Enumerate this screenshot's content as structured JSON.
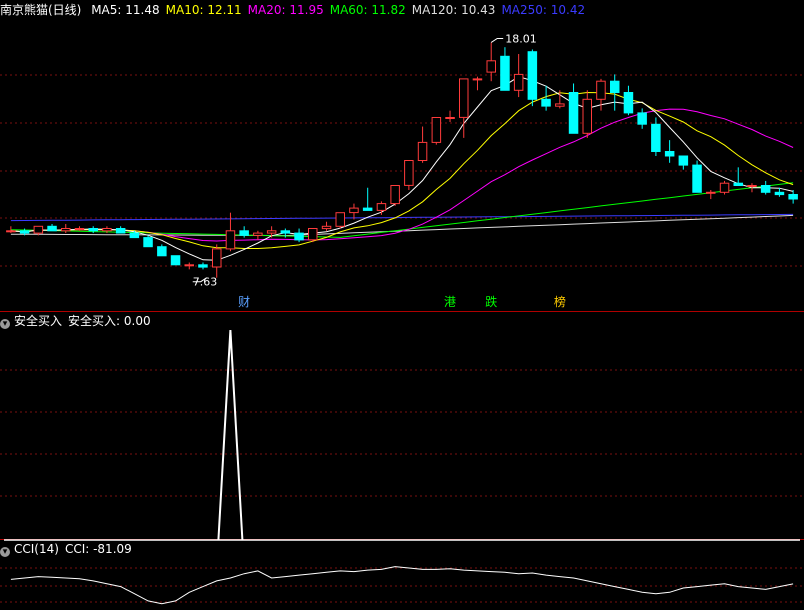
{
  "panels": {
    "main": {
      "title": "南京熊猫(日线)",
      "legend": [
        {
          "label": "MA5: 11.48",
          "color": "#ffffff"
        },
        {
          "label": "MA10: 12.11",
          "color": "#ffff00"
        },
        {
          "label": "MA20: 11.95",
          "color": "#ff00ff"
        },
        {
          "label": "MA60: 11.82",
          "color": "#00ff00"
        },
        {
          "label": "MA120: 10.43",
          "color": "#dddddd"
        },
        {
          "label": "MA250: 10.42",
          "color": "#3b3bff"
        }
      ],
      "high_label": "18.01",
      "low_label": "7.63",
      "markers": [
        {
          "text": "财",
          "color": "#5aa0ff"
        },
        {
          "text": "港",
          "color": "#00ff00"
        },
        {
          "text": "跌",
          "color": "#00ff00"
        },
        {
          "text": "榜",
          "color": "#ffcc00"
        }
      ]
    },
    "indicator1": {
      "toggle_icon": "chevron-down-icon",
      "label": "安全买入",
      "value_text": "安全买入: 0.00"
    },
    "indicator2": {
      "toggle_icon": "chevron-down-icon",
      "label": "CCI(14)",
      "value_text": "CCI: -81.09"
    }
  },
  "colors": {
    "up": "#ff3b3b",
    "down": "#00ffff",
    "grid": "#7a1010",
    "separator": "#b00000"
  },
  "chart_data": [
    {
      "type": "candlestick",
      "title": "南京熊猫(日线)",
      "unit": "price",
      "series_ma": [
        "MA5",
        "MA10",
        "MA20",
        "MA60",
        "MA120",
        "MA250"
      ],
      "candles": [
        [
          9.7,
          9.9,
          9.6,
          9.7
        ],
        [
          9.7,
          9.8,
          9.5,
          9.6
        ],
        [
          9.6,
          9.9,
          9.5,
          9.9
        ],
        [
          9.9,
          10.0,
          9.7,
          9.7
        ],
        [
          9.7,
          10.0,
          9.6,
          9.8
        ],
        [
          9.8,
          9.9,
          9.7,
          9.8
        ],
        [
          9.8,
          9.9,
          9.6,
          9.7
        ],
        [
          9.7,
          9.9,
          9.6,
          9.8
        ],
        [
          9.8,
          9.9,
          9.6,
          9.6
        ],
        [
          9.6,
          9.7,
          9.4,
          9.4
        ],
        [
          9.4,
          9.5,
          9.0,
          9.0
        ],
        [
          9.0,
          9.1,
          8.6,
          8.6
        ],
        [
          8.6,
          8.6,
          8.2,
          8.2
        ],
        [
          8.2,
          8.3,
          8.0,
          8.2
        ],
        [
          8.2,
          8.3,
          8.0,
          8.1
        ],
        [
          8.1,
          9.1,
          7.63,
          8.9
        ],
        [
          8.9,
          10.5,
          8.8,
          9.7
        ],
        [
          9.7,
          9.9,
          9.4,
          9.5
        ],
        [
          9.5,
          9.7,
          9.3,
          9.6
        ],
        [
          9.6,
          9.9,
          9.4,
          9.7
        ],
        [
          9.7,
          9.8,
          9.4,
          9.6
        ],
        [
          9.6,
          9.8,
          9.2,
          9.3
        ],
        [
          9.3,
          9.8,
          9.2,
          9.8
        ],
        [
          9.8,
          10.1,
          9.7,
          9.9
        ],
        [
          9.9,
          10.5,
          9.8,
          10.5
        ],
        [
          10.5,
          10.9,
          10.2,
          10.7
        ],
        [
          10.7,
          11.6,
          10.6,
          10.6
        ],
        [
          10.6,
          11.0,
          10.4,
          10.9
        ],
        [
          10.9,
          11.3,
          10.8,
          11.7
        ],
        [
          11.7,
          12.8,
          11.5,
          12.8
        ],
        [
          12.8,
          14.3,
          12.7,
          13.6
        ],
        [
          13.6,
          14.7,
          13.5,
          14.7
        ],
        [
          14.7,
          15.0,
          14.5,
          14.7
        ],
        [
          14.7,
          16.4,
          13.8,
          16.4
        ],
        [
          16.4,
          16.5,
          15.9,
          16.4
        ],
        [
          16.7,
          18.01,
          16.3,
          17.2
        ],
        [
          17.4,
          17.8,
          16.5,
          15.9
        ],
        [
          15.9,
          17.5,
          15.6,
          16.6
        ],
        [
          17.6,
          17.7,
          15.2,
          15.5
        ],
        [
          15.5,
          16.1,
          15.0,
          15.2
        ],
        [
          15.2,
          15.9,
          15.1,
          15.3
        ],
        [
          15.8,
          16.2,
          14.3,
          14.0
        ],
        [
          14.0,
          15.9,
          13.8,
          15.5
        ],
        [
          15.5,
          16.4,
          15.0,
          16.3
        ],
        [
          16.3,
          16.6,
          15.0,
          15.8
        ],
        [
          15.8,
          16.1,
          14.8,
          14.9
        ],
        [
          14.9,
          15.1,
          14.2,
          14.4
        ],
        [
          14.4,
          14.7,
          13.0,
          13.2
        ],
        [
          13.2,
          13.7,
          12.7,
          13.0
        ],
        [
          13.0,
          13.0,
          12.4,
          12.6
        ],
        [
          12.6,
          12.8,
          11.8,
          11.4
        ],
        [
          11.4,
          11.5,
          11.1,
          11.4
        ],
        [
          11.4,
          11.9,
          11.3,
          11.8
        ],
        [
          11.8,
          12.5,
          11.7,
          11.7
        ],
        [
          11.7,
          11.8,
          11.4,
          11.7
        ],
        [
          11.7,
          11.9,
          11.3,
          11.4
        ],
        [
          11.4,
          11.6,
          11.2,
          11.3
        ],
        [
          11.3,
          11.5,
          10.9,
          11.1
        ]
      ],
      "ylim": [
        7.0,
        19.0
      ]
    },
    {
      "type": "line",
      "title": "安全买入",
      "values": [
        0,
        0,
        0,
        0,
        0,
        0,
        0,
        0,
        0,
        0,
        0,
        0,
        0,
        0,
        0,
        0,
        1,
        0,
        0,
        0,
        0,
        0,
        0,
        0,
        0,
        0,
        0,
        0,
        0,
        0,
        0,
        0,
        0,
        0,
        0,
        0,
        0,
        0,
        0,
        0,
        0,
        0,
        0,
        0,
        0,
        0,
        0,
        0,
        0,
        0,
        0,
        0,
        0,
        0,
        0,
        0,
        0,
        0
      ],
      "ylim": [
        0,
        1
      ]
    },
    {
      "type": "line",
      "title": "CCI(14)",
      "values": [
        -50,
        -40,
        -30,
        -35,
        -40,
        -45,
        -60,
        -80,
        -100,
        -150,
        -200,
        -220,
        -200,
        -140,
        -100,
        -60,
        -40,
        -10,
        10,
        -40,
        -30,
        -20,
        -10,
        0,
        10,
        5,
        15,
        20,
        40,
        30,
        20,
        20,
        25,
        15,
        10,
        5,
        0,
        -10,
        -5,
        -20,
        -30,
        -40,
        -60,
        -80,
        -100,
        -120,
        -140,
        -150,
        -140,
        -110,
        -100,
        -90,
        -80,
        -100,
        -110,
        -120,
        -100,
        -81.09
      ],
      "ylim": [
        -250,
        100
      ]
    }
  ]
}
